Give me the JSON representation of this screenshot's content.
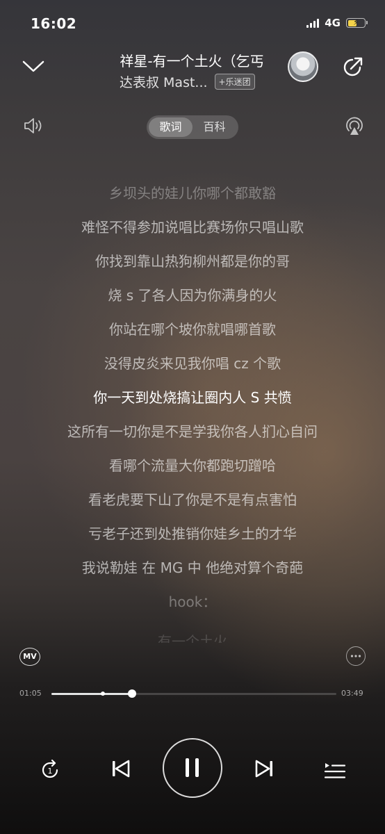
{
  "status": {
    "time": "16:02",
    "network": "4G",
    "battery_level": 0.55,
    "battery_color": "#f5d34a"
  },
  "header": {
    "title": "祥星-有一个土火（乞丐",
    "artist": "达表叔 Mast...",
    "fan_button": "+乐迷团"
  },
  "tabs": [
    {
      "label": "歌词",
      "active": true
    },
    {
      "label": "百科",
      "active": false
    }
  ],
  "lyrics": {
    "current_index": 6,
    "lines": [
      "乡坝头的娃儿你哪个都敢豁",
      "难怪不得参加说唱比赛场你只唱山歌",
      "你找到靠山热狗柳州都是你的哥",
      "烧 s 了各人因为你满身的火",
      "你站在哪个坡你就唱哪首歌",
      "没得皮炎来见我你唱 cz 个歌",
      "你一天到处烧搞让圈内人 S 共愤",
      "这所有一切你是不是学我你各人扪心自问",
      "看哪个流量大你都跑切蹭哈",
      "看老虎要下山了你是不是有点害怕",
      "亏老子还到处推销你娃乡土的才华",
      "我说勒娃 在 MG 中 他绝对算个奇葩",
      "hook：",
      "有一个土火"
    ]
  },
  "mv_label": "MV",
  "progress": {
    "current": "01:05",
    "total": "03:49",
    "played": 0.283,
    "buffered": 0.18
  },
  "controls": {
    "repeat_count": "1"
  }
}
